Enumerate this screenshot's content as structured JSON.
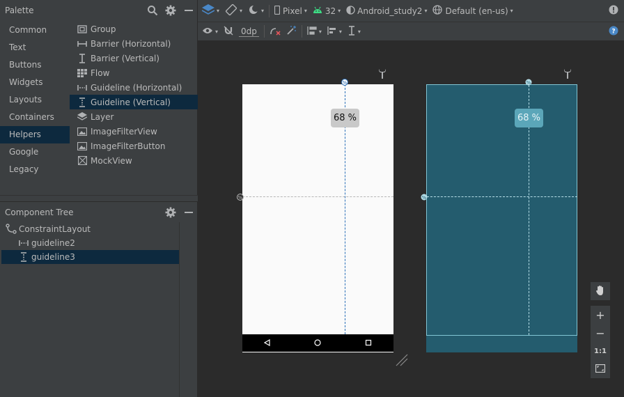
{
  "palette": {
    "title": "Palette",
    "categories": [
      "Common",
      "Text",
      "Buttons",
      "Widgets",
      "Layouts",
      "Containers",
      "Helpers",
      "Google",
      "Legacy"
    ],
    "selected_category": "Helpers",
    "items": [
      {
        "label": "Group",
        "icon": "group-icon"
      },
      {
        "label": "Barrier (Horizontal)",
        "icon": "barrier-horizontal-icon"
      },
      {
        "label": "Barrier (Vertical)",
        "icon": "barrier-vertical-icon"
      },
      {
        "label": "Flow",
        "icon": "flow-icon"
      },
      {
        "label": "Guideline (Horizontal)",
        "icon": "guideline-horizontal-icon"
      },
      {
        "label": "Guideline (Vertical)",
        "icon": "guideline-vertical-icon"
      },
      {
        "label": "Layer",
        "icon": "layer-icon"
      },
      {
        "label": "ImageFilterView",
        "icon": "image-icon"
      },
      {
        "label": "ImageFilterButton",
        "icon": "image-icon"
      },
      {
        "label": "MockView",
        "icon": "mockview-icon"
      }
    ],
    "selected_item": "Guideline (Vertical)"
  },
  "component_tree": {
    "title": "Component Tree",
    "nodes": [
      {
        "label": "ConstraintLayout",
        "icon": "constraint-layout-icon"
      },
      {
        "label": "guideline2",
        "icon": "guideline-horizontal-icon"
      },
      {
        "label": "guideline3",
        "icon": "guideline-vertical-icon"
      }
    ],
    "selected_node": "guideline3"
  },
  "toolbar": {
    "device": "Pixel",
    "api": "32",
    "theme": "Android_study2",
    "locale": "Default (en-us)",
    "margin": "0dp"
  },
  "canvas": {
    "guideline_percent_label": "68 %",
    "guideline_percent": 68
  },
  "zoom": {
    "zoom_in": "+",
    "zoom_out": "−",
    "actual_size": "1:1"
  },
  "colors": {
    "selection": "#0d293e",
    "blueprint": "#245c6e",
    "accent": "#4a88c7"
  }
}
